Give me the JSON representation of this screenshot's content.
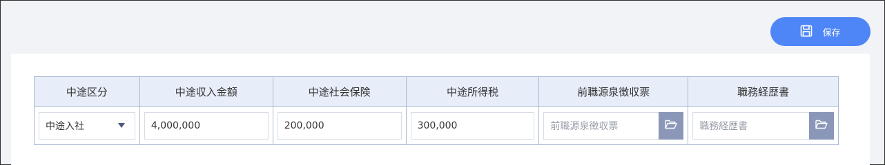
{
  "toolbar": {
    "save_label": "保存",
    "save_icon": "floppy-disk-icon",
    "accent_color": "#4f86f7"
  },
  "table": {
    "headers": [
      "中途区分",
      "中途収入金額",
      "中途社会保険",
      "中途所得税",
      "前職源泉徴収票",
      "職務経歴書"
    ],
    "row": {
      "category_selected": "中途入社",
      "income_amount": "4,000,000",
      "social_insurance": "200,000",
      "income_tax": "300,000",
      "withholding_placeholder": "前職源泉徴収票",
      "resume_placeholder": "職務経歴書"
    }
  }
}
